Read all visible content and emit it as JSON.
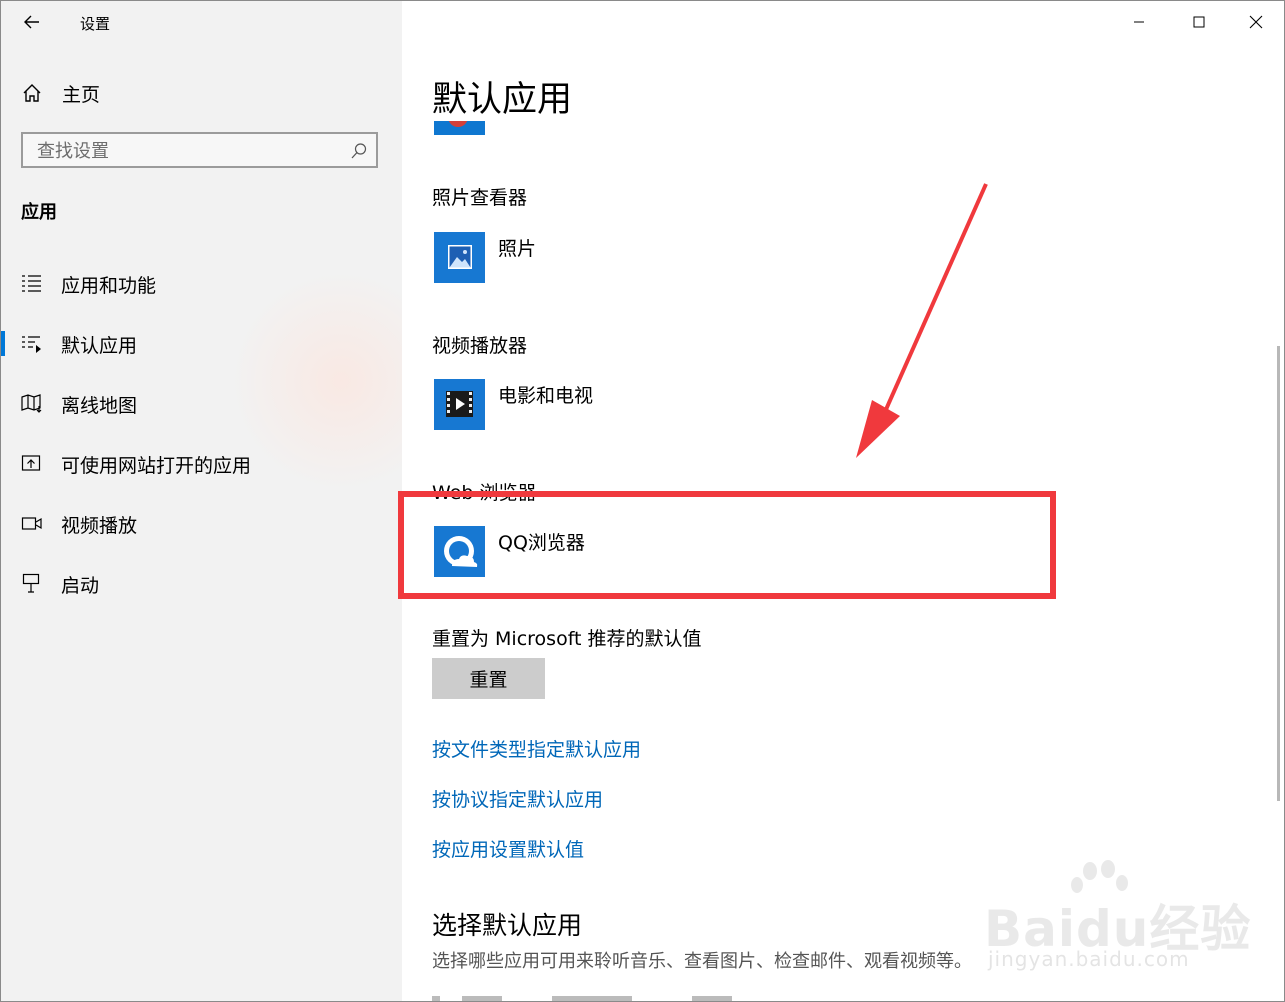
{
  "window": {
    "title": "设置"
  },
  "sidebar": {
    "home_label": "主页",
    "search_placeholder": "查找设置",
    "section_title": "应用",
    "items": [
      {
        "label": "应用和功能",
        "icon": "list-icon",
        "selected": false
      },
      {
        "label": "默认应用",
        "icon": "default-apps-icon",
        "selected": true
      },
      {
        "label": "离线地图",
        "icon": "map-icon",
        "selected": false
      },
      {
        "label": "可使用网站打开的应用",
        "icon": "open-website-icon",
        "selected": false
      },
      {
        "label": "视频播放",
        "icon": "video-icon",
        "selected": false
      },
      {
        "label": "启动",
        "icon": "startup-icon",
        "selected": false
      }
    ]
  },
  "main": {
    "title": "默认应用",
    "categories": [
      {
        "label": "照片查看器",
        "app": "照片",
        "icon": "photos-icon"
      },
      {
        "label": "视频播放器",
        "app": "电影和电视",
        "icon": "movies-tv-icon"
      },
      {
        "label": "Web 浏览器",
        "app": "QQ浏览器",
        "icon": "qq-browser-icon"
      }
    ],
    "reset_label": "重置为 Microsoft 推荐的默认值",
    "reset_button": "重置",
    "links": [
      "按文件类型指定默认应用",
      "按协议指定默认应用",
      "按应用设置默认值"
    ],
    "choose_title": "选择默认应用",
    "choose_desc": "选择哪些应用可用来聆听音乐、查看图片、检查邮件、观看视频等。"
  },
  "watermark": {
    "text": "Baidu经验",
    "sub": "jingyan.baidu.com"
  },
  "colors": {
    "accent": "#0078d7",
    "link": "#0067b8",
    "annotation": "#f0393d",
    "tile": "#1778d2"
  }
}
